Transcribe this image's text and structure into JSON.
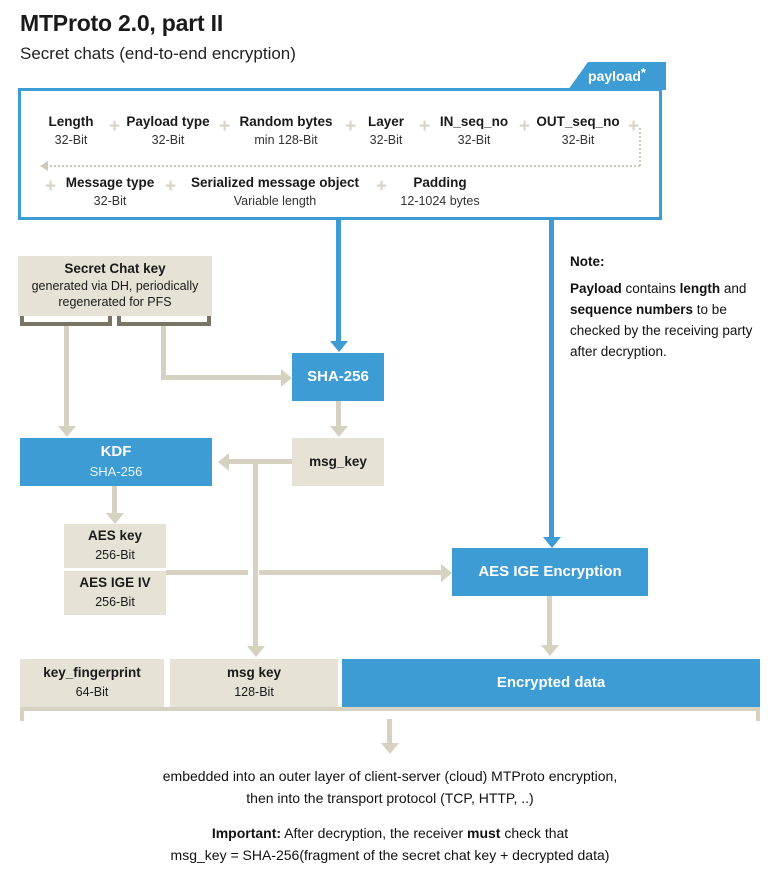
{
  "header": {
    "title": "MTProto 2.0, part II",
    "subtitle": "Secret chats (end-to-end encryption)"
  },
  "payload": {
    "tab_label": "payload",
    "tab_asterisk": "*",
    "row1": [
      {
        "name": "Length",
        "size": "32-Bit"
      },
      {
        "name": "Payload type",
        "size": "32-Bit"
      },
      {
        "name": "Random bytes",
        "size": "min 128-Bit"
      },
      {
        "name": "Layer",
        "size": "32-Bit"
      },
      {
        "name": "IN_seq_no",
        "size": "32-Bit"
      },
      {
        "name": "OUT_seq_no",
        "size": "32-Bit"
      }
    ],
    "row2": [
      {
        "name": "Message type",
        "size": "32-Bit"
      },
      {
        "name": "Serialized message object",
        "size": "Variable length"
      },
      {
        "name": "Padding",
        "size": "12-1024 bytes"
      }
    ],
    "plus": "+"
  },
  "nodes": {
    "secret_chat_key": {
      "title": "Secret Chat key",
      "sub_line1": "generated via DH, periodically",
      "sub_line2": "regenerated for PFS"
    },
    "sha256": {
      "label": "SHA-256"
    },
    "kdf": {
      "label": "KDF",
      "sub": "SHA-256"
    },
    "msg_key_small": {
      "label": "msg_key"
    },
    "aes_key": {
      "label": "AES key",
      "size": "256-Bit"
    },
    "aes_ige_iv": {
      "label": "AES IGE IV",
      "size": "256-Bit"
    },
    "aes_ige_encryption": {
      "label": "AES IGE Encryption"
    },
    "key_fingerprint": {
      "label": "key_fingerprint",
      "size": "64-Bit"
    },
    "msg_key_out": {
      "label": "msg key",
      "size": "128-Bit"
    },
    "encrypted_data": {
      "label": "Encrypted data"
    }
  },
  "note": {
    "header": "Note:",
    "b1": "Payload",
    "t1": " contains ",
    "b2": "length",
    "t2": " and ",
    "b3": "sequence numbers",
    "t3": " to be checked by the receiving party after decryption."
  },
  "footer": {
    "line1": "embedded into an outer layer of client-server (cloud) MTProto encryption,",
    "line2": "then into the transport protocol (TCP, HTTP, ..)",
    "important_label": "Important:",
    "important_text1": " After decryption, the receiver ",
    "important_bold": "must",
    "important_text2": " check that",
    "formula": "msg_key = SHA-256(fragment of the secret chat key + decrypted data)"
  },
  "colors": {
    "blue": "#3c9cd3",
    "beige": "#e7e2d6",
    "connector": "#d6d1c0",
    "bracket": "#7a7464"
  }
}
